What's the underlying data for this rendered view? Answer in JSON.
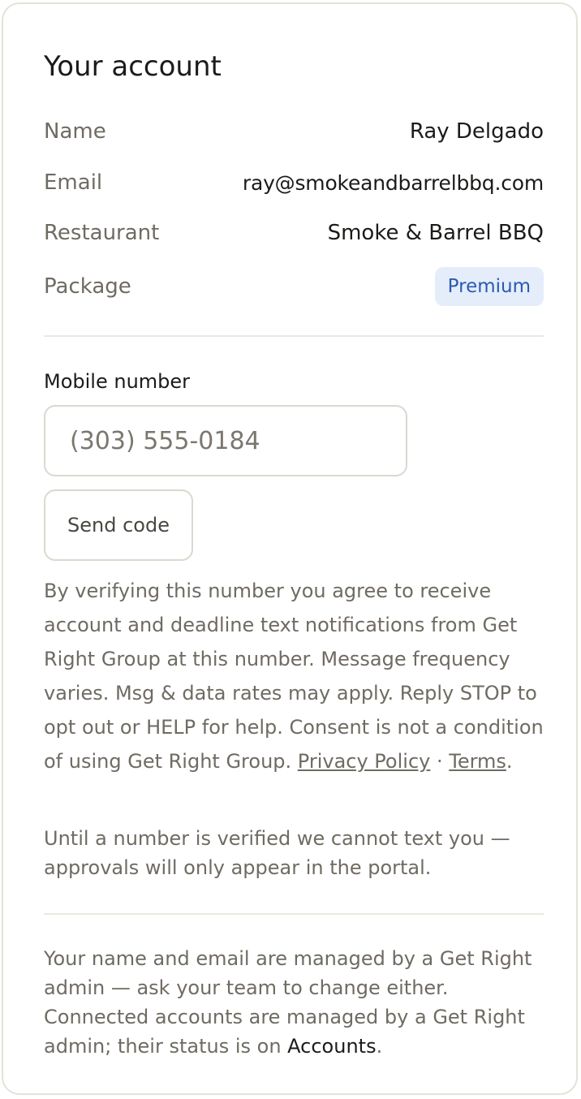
{
  "account": {
    "title": "Your account",
    "fields": {
      "name": {
        "label": "Name",
        "value": "Ray Delgado"
      },
      "email": {
        "label": "Email",
        "value": "ray@smokeandbarrelbbq.com"
      },
      "restaurant": {
        "label": "Restaurant",
        "value": "Smoke & Barrel BBQ"
      },
      "package": {
        "label": "Package",
        "value": "Premium"
      }
    },
    "colors": {
      "badge_bg": "#e5edfb",
      "badge_text": "#2a5bb0"
    }
  },
  "mobile": {
    "label": "Mobile number",
    "placeholder": "(303) 555-0184",
    "value": "",
    "send_label": "Send code"
  },
  "consent": {
    "text": "By verifying this number you agree to receive account and deadline text notifications from Get Right Group at this number. Message frequency varies. Msg & data rates may apply. Reply STOP to opt out or HELP for help. Consent is not a condition of using Get Right Group. ",
    "privacy_link": "Privacy Policy",
    "separator": " · ",
    "terms_link": "Terms",
    "end": "."
  },
  "notice": {
    "until_verified": "Until a number is verified we cannot text you — approvals will only appear in the portal."
  },
  "footer": {
    "text": "Your name and email are managed by a Get Right admin — ask your team to change either. Connected accounts are managed by a Get Right admin; their status is on ",
    "accounts_link": "Accounts",
    "end": "."
  }
}
